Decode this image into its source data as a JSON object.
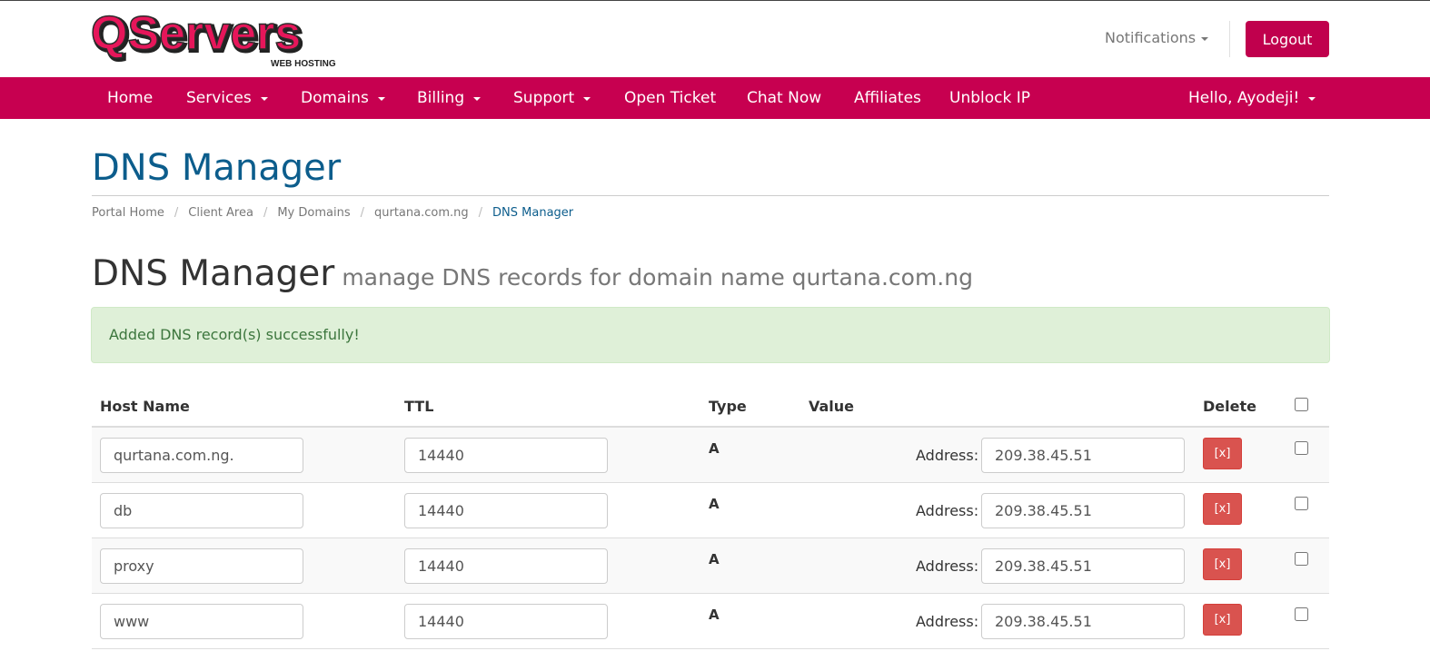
{
  "brand": {
    "logo_text": "QServers",
    "logo_tagline": "WEB HOSTING"
  },
  "header": {
    "notifications_label": "Notifications",
    "logout_label": "Logout"
  },
  "nav": {
    "items": [
      {
        "label": "Home"
      },
      {
        "label": "Services"
      },
      {
        "label": "Domains"
      },
      {
        "label": "Billing"
      },
      {
        "label": "Support"
      },
      {
        "label": "Open Ticket"
      },
      {
        "label": "Chat Now"
      },
      {
        "label": "Affiliates"
      },
      {
        "label": "Unblock IP"
      }
    ],
    "user_greeting": "Hello, Ayodeji!"
  },
  "page": {
    "title": "DNS Manager"
  },
  "breadcrumb": [
    "Portal Home",
    "Client Area",
    "My Domains",
    "qurtana.com.ng",
    "DNS Manager"
  ],
  "section": {
    "title": "DNS Manager",
    "subtitle": "manage DNS records for domain name qurtana.com.ng"
  },
  "alert": {
    "message": "Added DNS record(s) successfully!"
  },
  "table": {
    "headers": {
      "host": "Host Name",
      "ttl": "TTL",
      "type": "Type",
      "value": "Value",
      "delete": "Delete"
    },
    "rows": [
      {
        "host": "qurtana.com.ng.",
        "ttl": "14440",
        "type": "A",
        "value_label": "Address:",
        "value": "209.38.45.51",
        "delete_label": "[x]"
      },
      {
        "host": "db",
        "ttl": "14440",
        "type": "A",
        "value_label": "Address:",
        "value": "209.38.45.51",
        "delete_label": "[x]"
      },
      {
        "host": "proxy",
        "ttl": "14440",
        "type": "A",
        "value_label": "Address:",
        "value": "209.38.45.51",
        "delete_label": "[x]"
      },
      {
        "host": "www",
        "ttl": "14440",
        "type": "A",
        "value_label": "Address:",
        "value": "209.38.45.51",
        "delete_label": "[x]"
      }
    ]
  },
  "colors": {
    "brand": "#c70050",
    "title_blue": "#0c5d8c",
    "alert_bg": "#dff0d8",
    "alert_text": "#3c763d",
    "delete_red": "#d9534f"
  }
}
